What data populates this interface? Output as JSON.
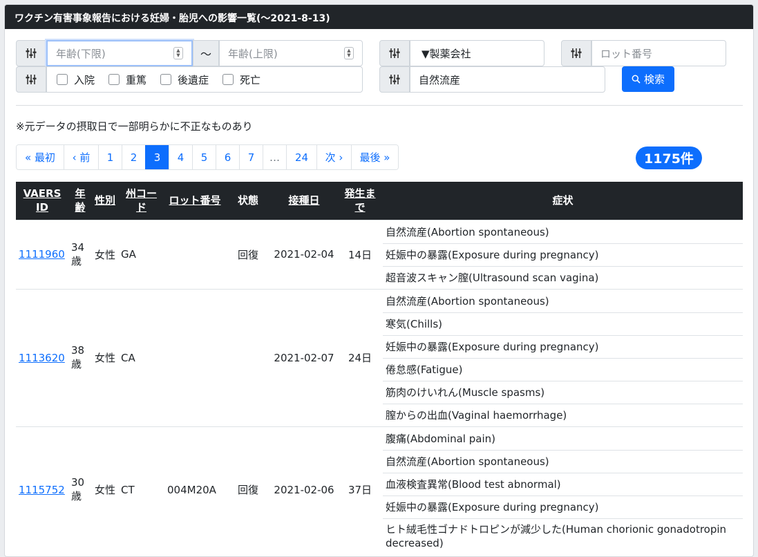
{
  "header": {
    "title": "ワクチン有害事象報告における妊婦・胎児への影響一覧(〜2021-8-13)"
  },
  "filters": {
    "age_min_placeholder": "年齢(下限)",
    "tilde": "〜",
    "age_max_placeholder": "年齢(上限)",
    "manufacturer_label": "▼製薬会社",
    "lot_placeholder": "ロット番号",
    "checks": [
      "入院",
      "重篤",
      "後遺症",
      "死亡"
    ],
    "symptom_value": "自然流産",
    "search_label": "検索"
  },
  "note": "※元データの摂取日で一部明らかに不正なものあり",
  "pagination": {
    "items": [
      "« 最初",
      "‹ 前",
      "1",
      "2",
      "3",
      "4",
      "5",
      "6",
      "7",
      "…",
      "24",
      "次 ›",
      "最後 »"
    ],
    "active": "3"
  },
  "count_badge": "1175件",
  "table": {
    "headers": {
      "vaers_id": "VAERS ID",
      "age": "年齢",
      "sex": "性別",
      "state": "州コード",
      "lot": "ロット番号",
      "status": "状態",
      "vax_date": "接種日",
      "onset": "発生まで",
      "symptoms": "症状"
    },
    "rows": [
      {
        "id": "1111960",
        "age": "34歳",
        "sex": "女性",
        "state": "GA",
        "lot": "",
        "status": "回復",
        "vax_date": "2021-02-04",
        "onset": "14日",
        "symptoms": [
          "自然流産(Abortion spontaneous)",
          "妊娠中の暴露(Exposure during pregnancy)",
          "超音波スキャン膣(Ultrasound scan vagina)"
        ]
      },
      {
        "id": "1113620",
        "age": "38歳",
        "sex": "女性",
        "state": "CA",
        "lot": "",
        "status": "",
        "vax_date": "2021-02-07",
        "onset": "24日",
        "symptoms": [
          "自然流産(Abortion spontaneous)",
          "寒気(Chills)",
          "妊娠中の暴露(Exposure during pregnancy)",
          "倦怠感(Fatigue)",
          "筋肉のけいれん(Muscle spasms)",
          "膣からの出血(Vaginal haemorrhage)"
        ]
      },
      {
        "id": "1115752",
        "age": "30歳",
        "sex": "女性",
        "state": "CT",
        "lot": "004M20A",
        "status": "回復",
        "vax_date": "2021-02-06",
        "onset": "37日",
        "symptoms": [
          "腹痛(Abdominal pain)",
          "自然流産(Abortion spontaneous)",
          "血液検査異常(Blood test abnormal)",
          "妊娠中の暴露(Exposure during pregnancy)",
          "ヒト絨毛性ゴナドトロピンが減少した(Human chorionic gonadotropin decreased)"
        ]
      }
    ]
  }
}
